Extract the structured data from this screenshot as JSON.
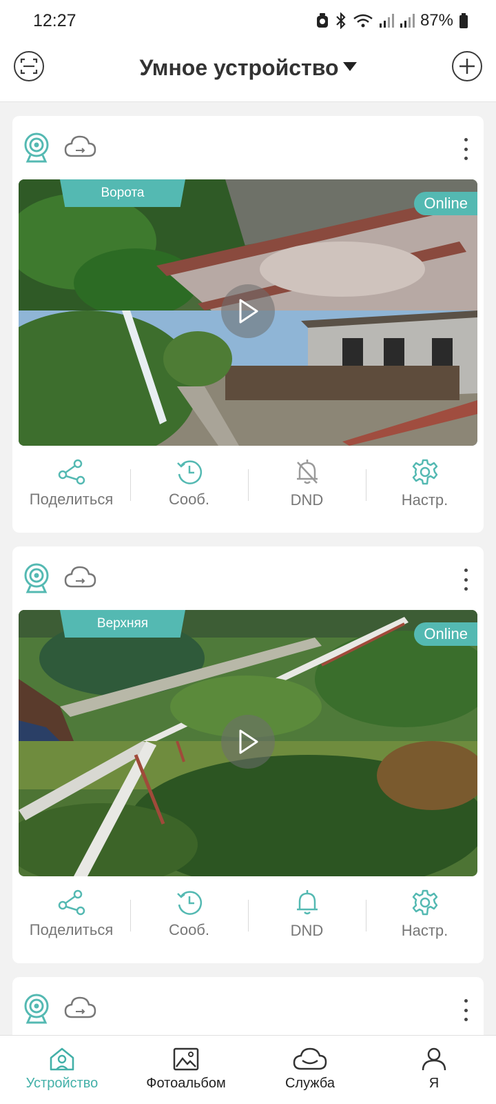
{
  "status_bar": {
    "time": "12:27",
    "battery": "87%"
  },
  "header": {
    "title": "Умное устройство"
  },
  "colors": {
    "accent": "#54b9b2",
    "text": "#333333",
    "muted": "#777777"
  },
  "devices": [
    {
      "name": "Ворота",
      "status": "Online",
      "dnd_enabled": true,
      "actions": {
        "share": "Поделиться",
        "messages": "Сооб.",
        "dnd": "DND",
        "settings": "Настр."
      }
    },
    {
      "name": "Верхняя",
      "status": "Online",
      "dnd_enabled": false,
      "actions": {
        "share": "Поделиться",
        "messages": "Сооб.",
        "dnd": "DND",
        "settings": "Настр."
      }
    }
  ],
  "bottom_nav": [
    {
      "label": "Устройство",
      "icon": "home-icon",
      "active": true
    },
    {
      "label": "Фотоальбом",
      "icon": "photo-icon",
      "active": false
    },
    {
      "label": "Служба",
      "icon": "cloud-icon",
      "active": false
    },
    {
      "label": "Я",
      "icon": "user-icon",
      "active": false
    }
  ]
}
